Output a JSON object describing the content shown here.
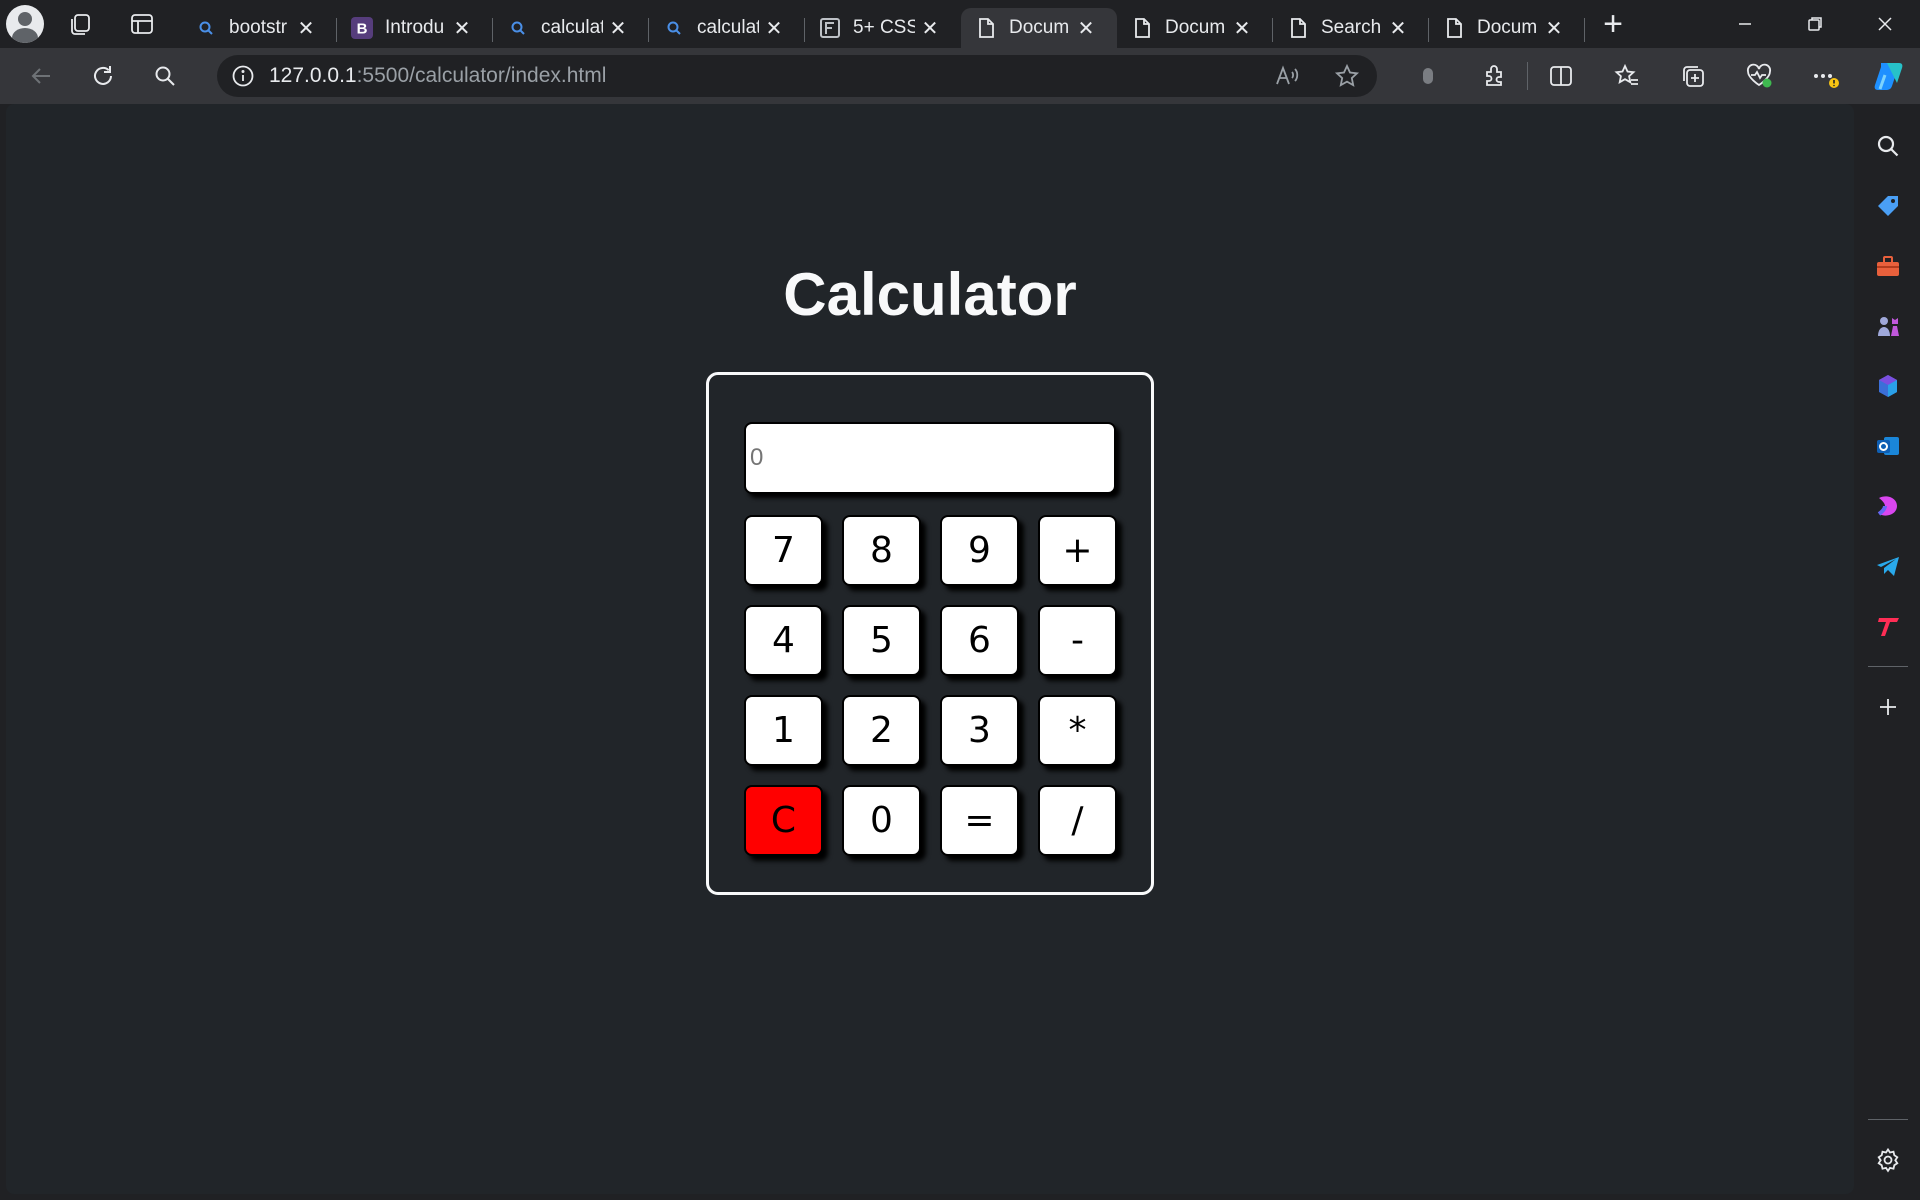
{
  "browser": {
    "tabs": [
      {
        "title": "bootstr",
        "favicon": "search-icon"
      },
      {
        "title": "Introdu",
        "favicon": "bootstrap-icon"
      },
      {
        "title": "calculat",
        "favicon": "search-icon"
      },
      {
        "title": "calculat",
        "favicon": "search-icon"
      },
      {
        "title": "5+ CSS",
        "favicon": "f-logo-icon"
      },
      {
        "title": "Docum",
        "favicon": "document-icon",
        "active": true
      },
      {
        "title": "Docum",
        "favicon": "document-icon"
      },
      {
        "title": "Search",
        "favicon": "document-icon"
      },
      {
        "title": "Docum",
        "favicon": "document-icon"
      }
    ],
    "address": {
      "host": "127.0.0.1",
      "path": ":5500/calculator/index.html"
    }
  },
  "page": {
    "title": "Calculator"
  },
  "calculator": {
    "display_placeholder": "0",
    "keys": [
      "7",
      "8",
      "9",
      "+",
      "4",
      "5",
      "6",
      "-",
      "1",
      "2",
      "3",
      "*",
      "C",
      "0",
      "=",
      "/"
    ],
    "clear_color": "#ff0000"
  },
  "colors": {
    "page_background": "#212529",
    "browser_chrome": "#202124",
    "toolbar": "#35363a"
  }
}
